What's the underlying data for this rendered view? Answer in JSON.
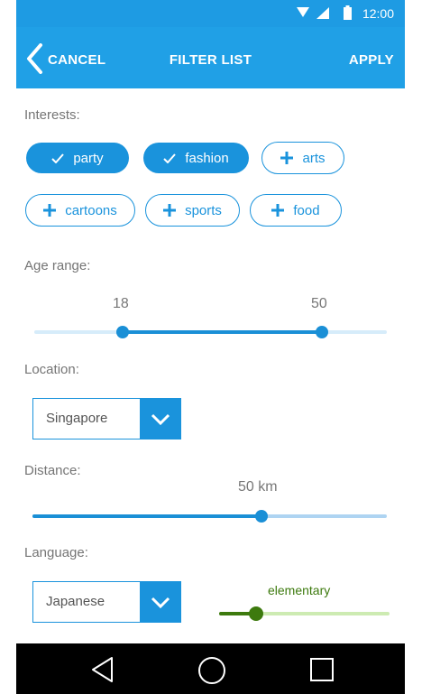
{
  "status_bar": {
    "time": "12:00",
    "color": "#1e9be3"
  },
  "app_bar": {
    "cancel_label": "CANCEL",
    "title": "FILTER LIST",
    "apply_label": "APPLY",
    "color": "#20a0e6"
  },
  "interests": {
    "label": "Interests:",
    "chips": [
      {
        "label": "party",
        "selected": true,
        "icon": "check-icon"
      },
      {
        "label": "fashion",
        "selected": true,
        "icon": "check-icon"
      },
      {
        "label": "arts",
        "selected": false,
        "icon": "plus-icon"
      },
      {
        "label": "cartoons",
        "selected": false,
        "icon": "plus-icon"
      },
      {
        "label": "sports",
        "selected": false,
        "icon": "plus-icon"
      },
      {
        "label": "food",
        "selected": false,
        "icon": "plus-icon"
      }
    ]
  },
  "age_range": {
    "label": "Age range:",
    "min_value": "18",
    "max_value": "50",
    "low_fraction": 0.25,
    "high_fraction": 0.82
  },
  "location": {
    "label": "Location:",
    "selected": "Singapore"
  },
  "distance": {
    "label": "Distance:",
    "value": "50 km",
    "fraction": 0.65
  },
  "language": {
    "label": "Language:",
    "selected": "Japanese",
    "level": "elementary",
    "level_fraction": 0.2,
    "level_color": "#3d7a0e"
  },
  "nav_bar": {
    "back": "back-icon",
    "home": "home-icon",
    "recents": "recents-icon"
  },
  "accent_color": "#1a93dc"
}
